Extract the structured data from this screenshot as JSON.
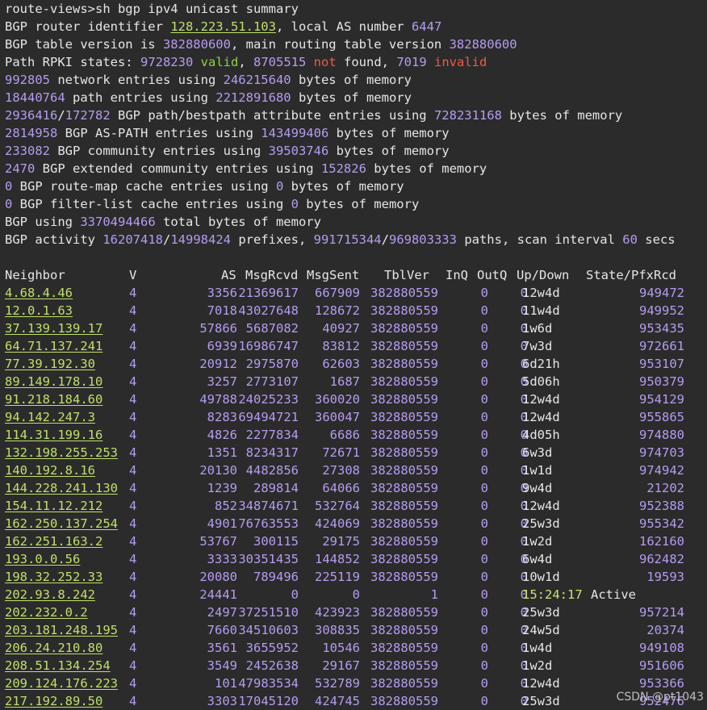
{
  "terminal": {
    "prompt": "route-views>sh bgp ipv4 unicast summary",
    "router_id_prefix": "BGP router identifier ",
    "router_id": "128.223.51.103",
    "local_as_text": ", local AS number ",
    "local_as": "6447",
    "table_version_text": "BGP table version is ",
    "table_version": "382880600",
    "main_version_text": ", main routing table version ",
    "main_version": "382880600",
    "rpki_text": "Path RPKI states: ",
    "rpki_valid_count": "9728230",
    "rpki_valid_word": "valid",
    "rpki_not_count": "8705515",
    "rpki_not_word": "not",
    "rpki_found_word": " found, ",
    "rpki_invalid_count": "7019",
    "rpki_invalid_word": "invalid",
    "mem_lines": [
      {
        "a": "992805",
        "b": " network entries using ",
        "c": "246215640",
        "d": " bytes of memory"
      },
      {
        "a": "18440764",
        "b": " path entries using ",
        "c": "2212891680",
        "d": " bytes of memory"
      },
      {
        "a": "2936416",
        "a2": "172782",
        "b": " BGP path/bestpath attribute entries using ",
        "c": "728231168",
        "d": " bytes of memory"
      },
      {
        "a": "2814958",
        "b": " BGP AS-PATH entries using ",
        "c": "143499406",
        "d": " bytes of memory"
      },
      {
        "a": "233082",
        "b": " BGP community entries using ",
        "c": "39503746",
        "d": " bytes of memory"
      },
      {
        "a": "2470",
        "b": " BGP extended community entries using ",
        "c": "152826",
        "d": " bytes of memory"
      },
      {
        "a": "0",
        "b": " BGP route-map cache entries using ",
        "c": "0",
        "d": " bytes of memory"
      },
      {
        "a": "0",
        "b": " BGP filter-list cache entries using ",
        "c": "0",
        "d": " bytes of memory"
      }
    ],
    "total_text": "BGP using ",
    "total_bytes": "3370494466",
    "total_tail": " total bytes of memory",
    "activity_text": "BGP activity ",
    "activity_prefixes": "16207418",
    "activity_prefixes2": "14998424",
    "activity_prefixes_word": " prefixes, ",
    "activity_paths": "991715344",
    "activity_paths2": "969803333",
    "activity_paths_word": " paths, scan interval ",
    "scan_interval": "60",
    "scan_unit": " secs"
  },
  "table": {
    "headers": [
      "Neighbor",
      "V",
      "AS",
      "MsgRcvd",
      "MsgSent",
      "TblVer",
      "InQ",
      "OutQ",
      "Up/Down",
      "State/PfxRcd"
    ],
    "rows": [
      [
        "4.68.4.46",
        "4",
        "3356",
        "21369617",
        "667909",
        "382880559",
        "0",
        "0",
        "12w4d",
        "949472"
      ],
      [
        "12.0.1.63",
        "4",
        "7018",
        "43027648",
        "128672",
        "382880559",
        "0",
        "0",
        "11w4d",
        "949952"
      ],
      [
        "37.139.139.17",
        "4",
        "57866",
        "5687082",
        "40927",
        "382880559",
        "0",
        "0",
        "1w6d",
        "953435"
      ],
      [
        "64.71.137.241",
        "4",
        "6939",
        "16986747",
        "83812",
        "382880559",
        "0",
        "0",
        "7w3d",
        "972661"
      ],
      [
        "77.39.192.30",
        "4",
        "20912",
        "2975870",
        "62603",
        "382880559",
        "0",
        "0",
        "6d21h",
        "953107"
      ],
      [
        "89.149.178.10",
        "4",
        "3257",
        "2773107",
        "1687",
        "382880559",
        "0",
        "0",
        "5d06h",
        "950379"
      ],
      [
        "91.218.184.60",
        "4",
        "49788",
        "24025233",
        "360020",
        "382880559",
        "0",
        "0",
        "12w4d",
        "954129"
      ],
      [
        "94.142.247.3",
        "4",
        "8283",
        "69494721",
        "360047",
        "382880559",
        "0",
        "0",
        "12w4d",
        "955865"
      ],
      [
        "114.31.199.16",
        "4",
        "4826",
        "2277834",
        "6686",
        "382880559",
        "0",
        "0",
        "4d05h",
        "974880"
      ],
      [
        "132.198.255.253",
        "4",
        "1351",
        "8234317",
        "72671",
        "382880559",
        "0",
        "0",
        "6w3d",
        "974703"
      ],
      [
        "140.192.8.16",
        "4",
        "20130",
        "4482856",
        "27308",
        "382880559",
        "0",
        "0",
        "1w1d",
        "974942"
      ],
      [
        "144.228.241.130",
        "4",
        "1239",
        "289814",
        "64066",
        "382880559",
        "0",
        "0",
        "9w4d",
        "21202"
      ],
      [
        "154.11.12.212",
        "4",
        "852",
        "34874671",
        "532764",
        "382880559",
        "0",
        "0",
        "12w4d",
        "952388"
      ],
      [
        "162.250.137.254",
        "4",
        "4901",
        "76763553",
        "424069",
        "382880559",
        "0",
        "0",
        "25w3d",
        "955342"
      ],
      [
        "162.251.163.2",
        "4",
        "53767",
        "300115",
        "29175",
        "382880559",
        "0",
        "0",
        "1w2d",
        "162160"
      ],
      [
        "193.0.0.56",
        "4",
        "3333",
        "30351435",
        "144852",
        "382880559",
        "0",
        "0",
        "6w4d",
        "962482"
      ],
      [
        "198.32.252.33",
        "4",
        "20080",
        "789496",
        "225119",
        "382880559",
        "0",
        "0",
        "10w1d",
        "19593"
      ],
      [
        "202.93.8.242",
        "4",
        "24441",
        "0",
        "0",
        "1",
        "0",
        "0",
        "15:24:17",
        "Active"
      ],
      [
        "202.232.0.2",
        "4",
        "2497",
        "37251510",
        "423923",
        "382880559",
        "0",
        "0",
        "25w3d",
        "957214"
      ],
      [
        "203.181.248.195",
        "4",
        "7660",
        "34510603",
        "308835",
        "382880559",
        "0",
        "0",
        "24w5d",
        "20374"
      ],
      [
        "206.24.210.80",
        "4",
        "3561",
        "3655952",
        "10546",
        "382880559",
        "0",
        "0",
        "1w4d",
        "949108"
      ],
      [
        "208.51.134.254",
        "4",
        "3549",
        "2452638",
        "29167",
        "382880559",
        "0",
        "0",
        "1w2d",
        "951606"
      ],
      [
        "209.124.176.223",
        "4",
        "101",
        "47983534",
        "532789",
        "382880559",
        "0",
        "0",
        "12w4d",
        "953366"
      ],
      [
        "217.192.89.50",
        "4",
        "3303",
        "17045120",
        "424745",
        "382880559",
        "0",
        "0",
        "25w3d",
        "952476"
      ]
    ]
  },
  "watermark": "CSDN @pt1043",
  "colors": {
    "background": "#2b2b2b",
    "text": "#e6e6e6",
    "number": "#b69cf0",
    "ip_link": "#bfe06a",
    "valid": "#8ed04a",
    "invalid": "#ef5a4a"
  }
}
